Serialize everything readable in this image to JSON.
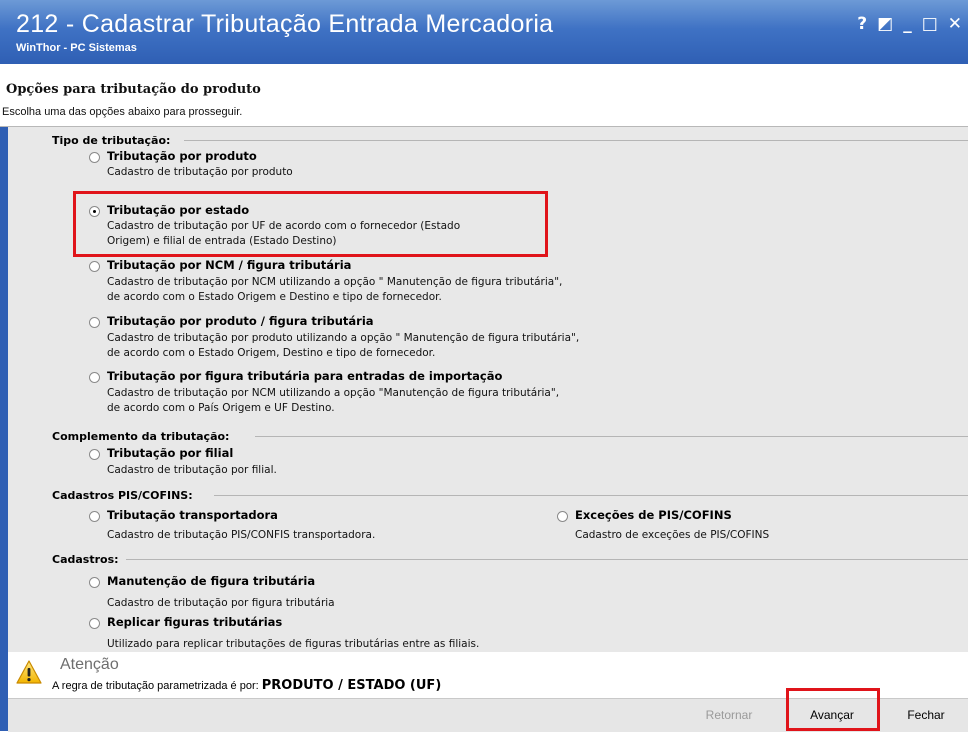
{
  "window": {
    "title": "212 - Cadastrar Tributação Entrada Mercadoria",
    "subtitle": "WinThor - PC Sistemas",
    "controls": [
      "?",
      "◩",
      "_",
      "□",
      "✕"
    ]
  },
  "header": {
    "title": "Opções para tributação do produto",
    "subtitle": "Escolha uma das opções abaixo para prosseguir."
  },
  "groups": {
    "tipo": "Tipo de tributação:",
    "complemento": "Complemento da tributação:",
    "pis": "Cadastros PIS/COFINS:",
    "cadastros": "Cadastros:"
  },
  "options": {
    "produto": {
      "label": "Tributação por produto",
      "desc1": "Cadastro de tributação por produto",
      "selected": false
    },
    "estado": {
      "label": "Tributação por estado",
      "desc1": "Cadastro de tributação por UF de acordo com o fornecedor (Estado",
      "desc2": "Origem) e filial de entrada (Estado Destino)",
      "selected": true
    },
    "ncm": {
      "label": "Tributação por NCM / figura tributária",
      "desc1": "Cadastro de tributação por NCM utilizando a opção \" Manutenção de figura tributária\",",
      "desc2": "de acordo com o Estado Origem e Destino e tipo de fornecedor.",
      "selected": false
    },
    "produto_figura": {
      "label": "Tributação por produto / figura tributária",
      "desc1": "Cadastro de tributação por produto utilizando a opção \" Manutenção de figura tributária\",",
      "desc2": "de acordo com o Estado Origem, Destino e tipo de fornecedor.",
      "selected": false
    },
    "importacao": {
      "label": "Tributação por figura tributária para entradas de importação",
      "desc1": "Cadastro de tributação por NCM utilizando a opção \"Manutenção de figura tributária\",",
      "desc2": "de acordo com o País Origem e UF Destino.",
      "selected": false
    },
    "filial": {
      "label": "Tributação por filial",
      "desc1": "Cadastro de tributação por filial.",
      "selected": false
    },
    "transportadora": {
      "label": "Tributação  transportadora",
      "desc1": "Cadastro de tributação PIS/CONFIS transportadora.",
      "selected": false
    },
    "excecoes": {
      "label": "Exceções de PIS/COFINS",
      "desc1": "Cadastro de exceções de PIS/COFINS",
      "selected": false
    },
    "manutencao": {
      "label": "Manutenção de figura tributária",
      "desc1": "Cadastro de tributação por figura tributária",
      "selected": false
    },
    "replicar": {
      "label": "Replicar figuras tributárias",
      "desc1": "Utilizado para replicar tributações de figuras tributárias entre as filiais.",
      "selected": false
    }
  },
  "attention": {
    "title": "Atenção",
    "text": "A regra de tributação parametrizada é por:",
    "value": "PRODUTO / ESTADO (UF)"
  },
  "buttons": {
    "back": "Retornar",
    "next": "Avançar",
    "close": "Fechar"
  },
  "colors": {
    "titlebar": "#3f72c4",
    "highlight": "#e0141a",
    "panel": "#e8e8e8"
  }
}
